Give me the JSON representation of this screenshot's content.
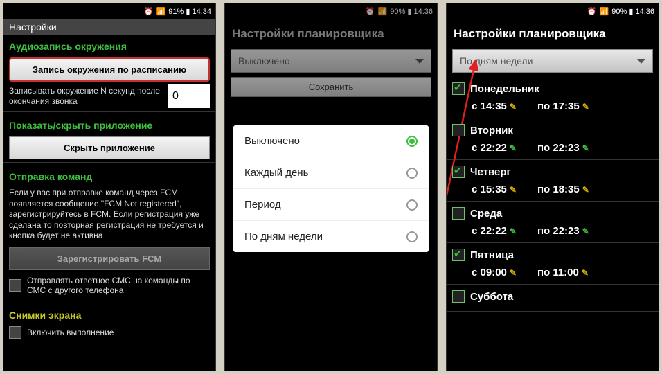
{
  "status": {
    "s1": "91% ▮ 14:34",
    "s2": "90% ▮ 14:36",
    "s3": "90% ▮ 14:36",
    "alarm": "⏰",
    "sig": "📶"
  },
  "p1": {
    "headerTitle": "Настройки",
    "sec1": "Аудиозапись окружения",
    "btn1": "Запись окружения по расписанию",
    "recLabel": "Записывать окружение N секунд после окончания звонка",
    "recValue": "0",
    "sec2": "Показать/скрыть приложение",
    "btn2": "Скрыть приложение",
    "sec3": "Отправка команд",
    "desc3": "Если у вас при отправке команд через FCM появляется сообщение \"FCM Not registered\", зарегистрируйтесь в FCM. Если регистрация уже сделана то повторная регистрация не требуется и кнопка будет не активна",
    "btn3": "Зарегистрировать FCM",
    "chk3": "Отправлять ответное СМС на команды по СМС с другого телефона",
    "sec4": "Снимки экрана",
    "chk4": "Включить выполнение"
  },
  "p2": {
    "title": "Настройки планировщика",
    "dropdown": "Выключено",
    "save": "Сохранить",
    "opts": [
      "Выключено",
      "Каждый день",
      "Период",
      "По дням недели"
    ]
  },
  "p3": {
    "title": "Настройки планировщика",
    "dropdown": "По дням недели",
    "days": [
      {
        "name": "Понедельник",
        "checked": true,
        "from": "14:35",
        "to": "17:35",
        "fromG": false,
        "toG": false
      },
      {
        "name": "Вторник",
        "checked": false,
        "from": "22:22",
        "to": "22:23",
        "fromG": true,
        "toG": true
      },
      {
        "name": "Четверг",
        "checked": true,
        "from": "15:35",
        "to": "18:35",
        "fromG": false,
        "toG": false
      },
      {
        "name": "Среда",
        "checked": false,
        "from": "22:22",
        "to": "22:23",
        "fromG": true,
        "toG": true
      },
      {
        "name": "Пятница",
        "checked": true,
        "from": "09:00",
        "to": "11:00",
        "fromG": false,
        "toG": false
      },
      {
        "name": "Суббота",
        "checked": false,
        "from": "",
        "to": "",
        "fromG": false,
        "toG": false
      }
    ],
    "fromPrefix": "с ",
    "toPrefix": "по "
  }
}
